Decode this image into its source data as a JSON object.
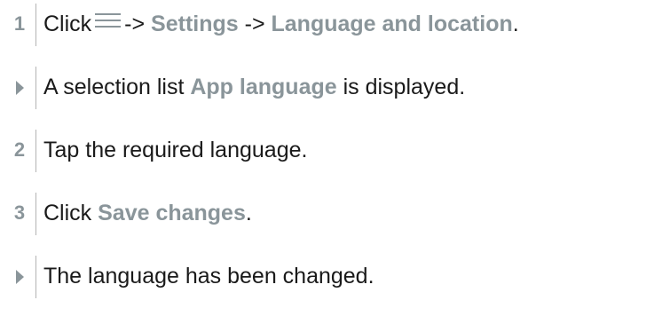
{
  "steps": [
    {
      "type": "step",
      "marker": "1",
      "segments": [
        {
          "text": "Click",
          "style": "normal"
        },
        {
          "icon": "hamburger-menu-icon"
        },
        {
          "text": "-> ",
          "style": "normal"
        },
        {
          "text": "Settings",
          "style": "highlight"
        },
        {
          "text": " -> ",
          "style": "normal"
        },
        {
          "text": "Language and location",
          "style": "highlight"
        },
        {
          "text": ".",
          "style": "normal"
        }
      ]
    },
    {
      "type": "result",
      "icon": "result-triangle-icon",
      "segments": [
        {
          "text": "A selection list ",
          "style": "normal"
        },
        {
          "text": "App language",
          "style": "highlight"
        },
        {
          "text": " is displayed.",
          "style": "normal"
        }
      ]
    },
    {
      "type": "step",
      "marker": "2",
      "segments": [
        {
          "text": "Tap the required language.",
          "style": "normal"
        }
      ]
    },
    {
      "type": "step",
      "marker": "3",
      "segments": [
        {
          "text": "Click ",
          "style": "normal"
        },
        {
          "text": "Save changes",
          "style": "highlight"
        },
        {
          "text": ".",
          "style": "normal"
        }
      ]
    },
    {
      "type": "result",
      "icon": "result-triangle-icon",
      "segments": [
        {
          "text": "The language has been changed.",
          "style": "normal"
        }
      ]
    }
  ],
  "colors": {
    "highlight": "#8a959a",
    "text": "#1a1a1a",
    "divider": "#b3b3b3"
  }
}
